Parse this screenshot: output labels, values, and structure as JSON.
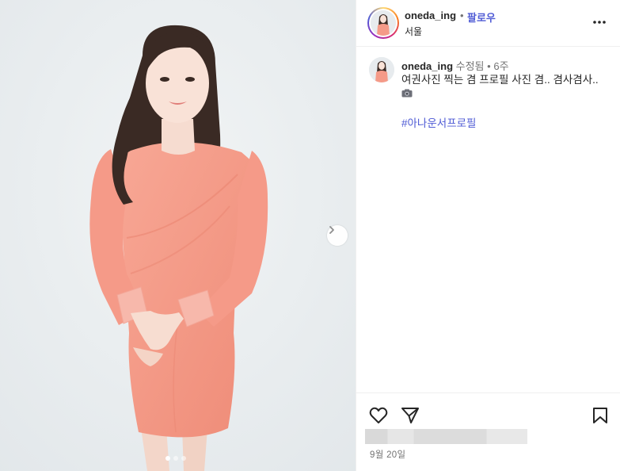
{
  "post": {
    "media": {
      "image_description_icon": "person-photo",
      "carousel_dots": [
        true,
        false,
        false
      ],
      "next_icon": "chevron-right-icon"
    },
    "header": {
      "username": "oneda_ing",
      "separator": "•",
      "follow_label": "팔로우",
      "location": "서울",
      "more_icon": "more-horizontal-icon"
    },
    "caption": {
      "username": "oneda_ing",
      "edited_label": "수정됨",
      "separator": "•",
      "time_ago": "6주",
      "text": "여권사진 찍는 겸 프로필 사진 겸.. 겸사겸사..",
      "emoji": "📷",
      "hashtag": "#아나운서프로필"
    },
    "actions": {
      "like_icon": "heart-icon",
      "share_icon": "send-icon",
      "save_icon": "bookmark-icon"
    },
    "date": "9월 20일"
  },
  "colors": {
    "link_blue": "#4f5bd5",
    "text": "#262626",
    "muted": "#737373",
    "dress": "#f59a88",
    "background": "#e9edef"
  }
}
